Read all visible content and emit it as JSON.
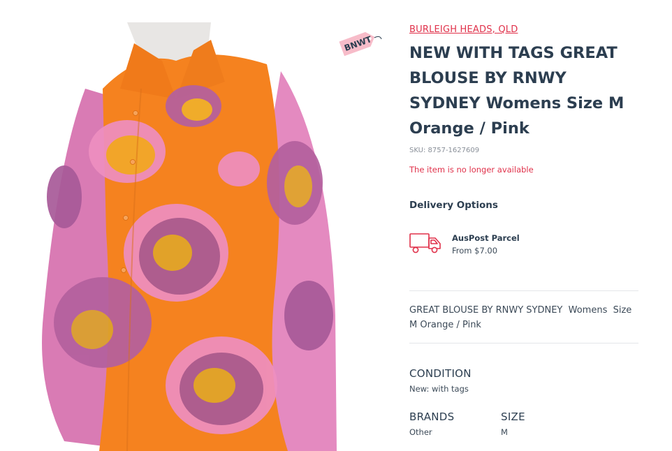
{
  "location": "BURLEIGH HEADS, QLD",
  "title": "NEW WITH TAGS GREAT BLOUSE BY RNWY SYDNEY Womens Size M Orange / Pink",
  "sku": "SKU: 8757-1627609",
  "availability": "The item is no longer available",
  "badge": "BNWT",
  "delivery": {
    "heading": "Delivery Options",
    "icon": "delivery-truck-icon",
    "option_name": "AusPost Parcel",
    "option_price": "From $7.00"
  },
  "description": "GREAT BLOUSE BY RNWY SYDNEY  Womens  Size M Orange / Pink",
  "attributes": {
    "condition": {
      "label": "CONDITION",
      "value": "New: with tags"
    },
    "brands": {
      "label": "BRANDS",
      "value": "Other"
    },
    "size": {
      "label": "SIZE",
      "value": "M"
    }
  },
  "colors": {
    "accent": "#e0314a",
    "heading": "#2c3e50",
    "blouse_orange": "#f5821f",
    "blouse_pink": "#ee8fc0",
    "blouse_purple": "#a85a98"
  }
}
